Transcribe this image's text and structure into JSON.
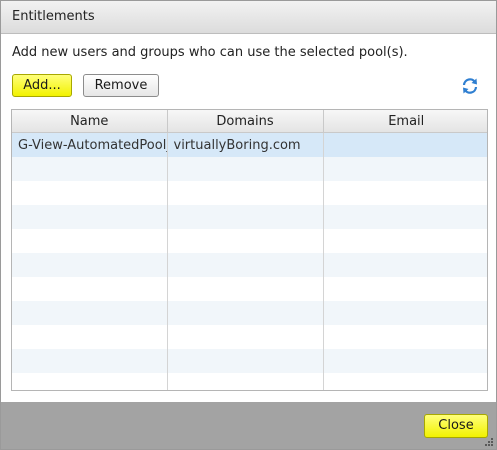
{
  "dialog": {
    "title": "Entitlements",
    "instruction": "Add new users and groups who can use the selected pool(s)."
  },
  "toolbar": {
    "add_label": "Add...",
    "remove_label": "Remove",
    "refresh_icon": "refresh-icon"
  },
  "table": {
    "columns": [
      "Name",
      "Domains",
      "Email"
    ],
    "rows": [
      {
        "name": "G-View-AutomatedPool_",
        "domain": "virtuallyBoring.com",
        "email": ""
      }
    ],
    "empty_rows": 10
  },
  "footer": {
    "close_label": "Close"
  },
  "colors": {
    "highlight": "#f2f200",
    "selected_row": "#d6e8f8",
    "footer_bg": "#a3a3a3"
  }
}
